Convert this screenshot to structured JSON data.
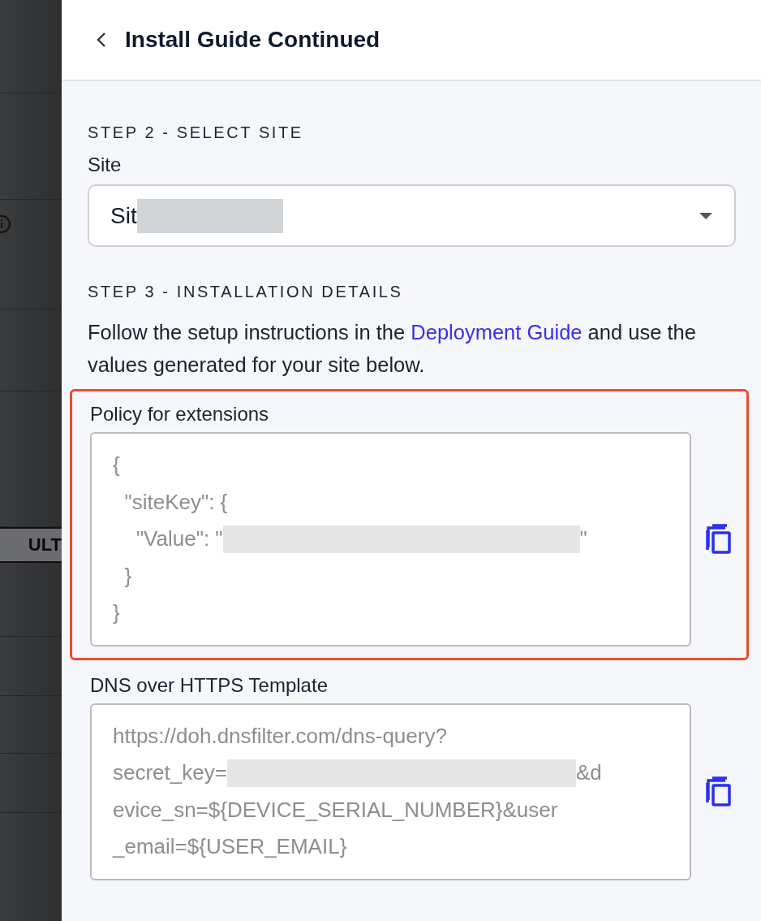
{
  "background": {
    "column_text": "ULT"
  },
  "title": "Install Guide Continued",
  "step2": {
    "heading": "STEP 2 - SELECT SITE",
    "label": "Site",
    "value": "Sit",
    "redacted": true
  },
  "step3": {
    "heading": "STEP 3 - INSTALLATION DETAILS",
    "before": "Follow the setup instructions in the ",
    "link": "Deployment Guide",
    "after": " and use the values generated for your site below."
  },
  "fields": [
    {
      "label": "Policy for extensions",
      "highlighted": true,
      "lines": [
        {
          "text": "{",
          "redacted": false
        },
        {
          "text": "  \"siteKey\": {",
          "redacted": false
        },
        {
          "text": "    \"Value\": \"",
          "redacted": true,
          "after": "\""
        },
        {
          "text": "  }",
          "redacted": false
        },
        {
          "text": "}",
          "redacted": false
        }
      ]
    },
    {
      "label": "DNS over HTTPS Template",
      "highlighted": false,
      "lines": [
        {
          "text": "https://doh.dnsfilter.com/dns-query?",
          "redacted": false
        },
        {
          "text": "secret_key=",
          "redacted": true,
          "after": "&d"
        },
        {
          "text": "evice_sn=${DEVICE_SERIAL_NUMBER}&user",
          "redacted": false
        },
        {
          "text": "_email=${USER_EMAIL}",
          "redacted": false
        }
      ]
    }
  ]
}
